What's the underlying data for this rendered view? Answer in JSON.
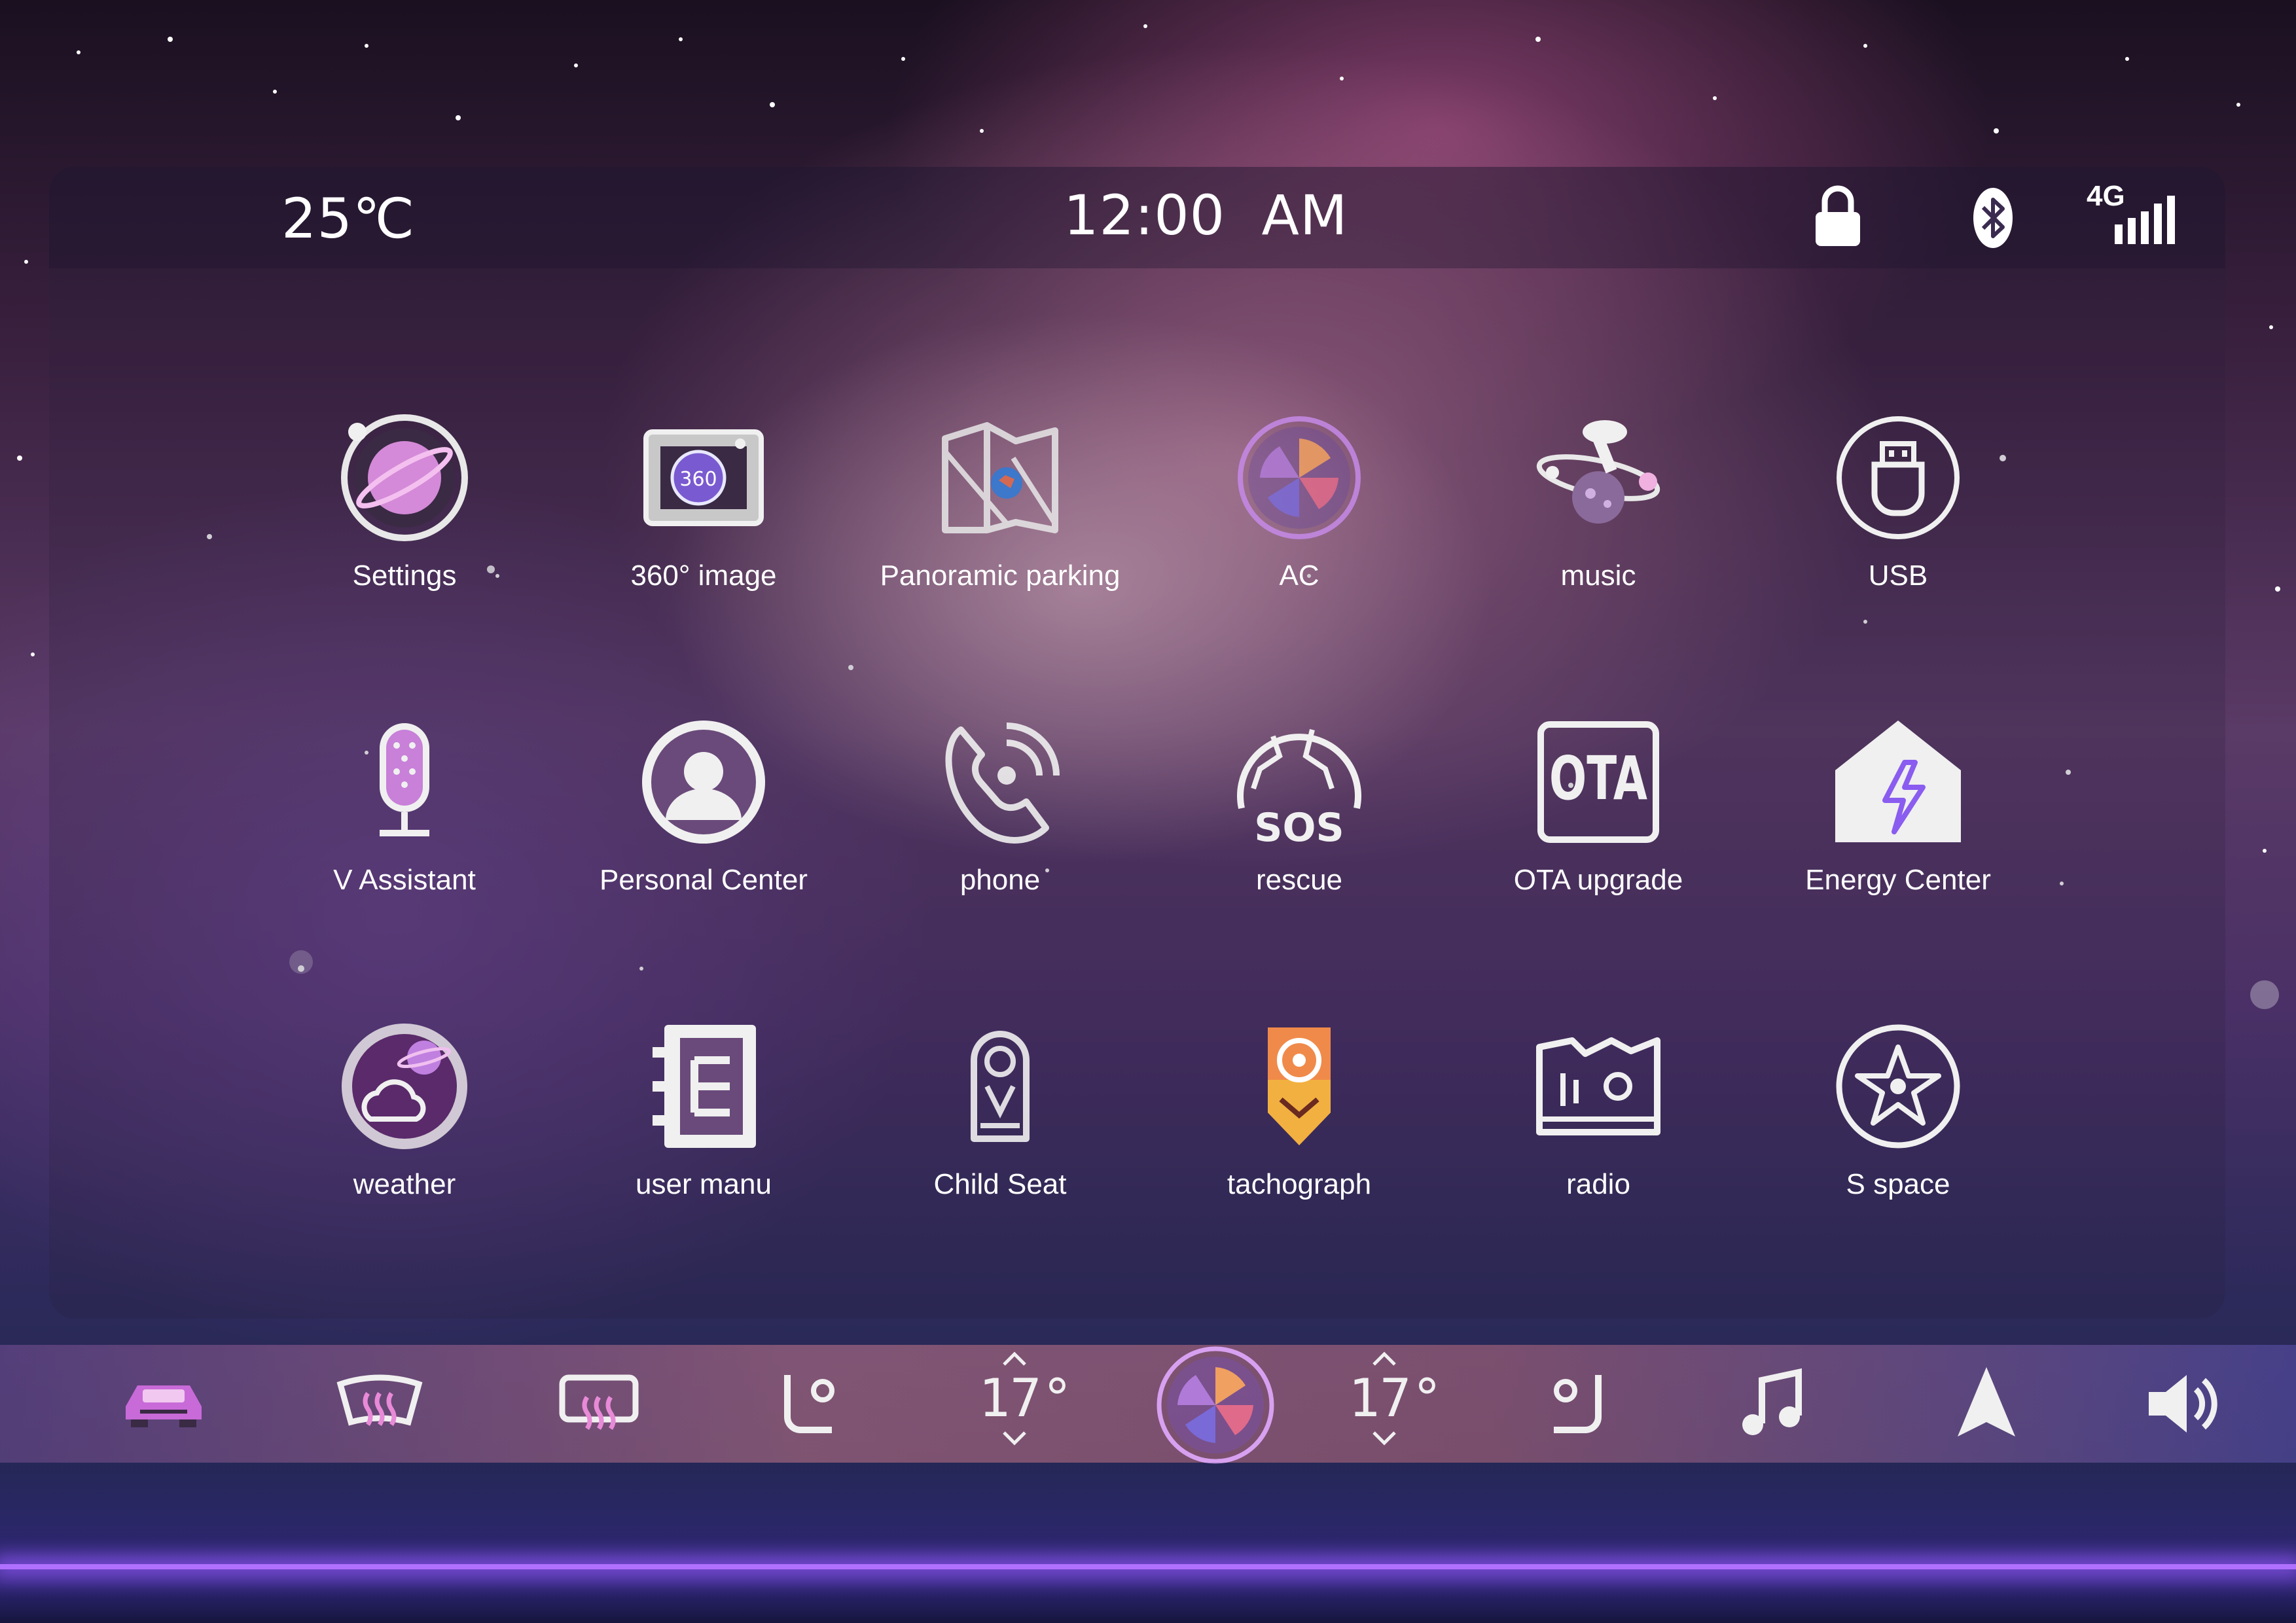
{
  "status": {
    "temperature": "25℃",
    "time": "12:00  AM",
    "network": "4G"
  },
  "apps": [
    {
      "label": "Settings",
      "icon": "settings-planet-icon"
    },
    {
      "label": "360° image",
      "icon": "camera-360-icon"
    },
    {
      "label": "Panoramic parking",
      "icon": "map-location-icon"
    },
    {
      "label": "AC",
      "icon": "fan-icon"
    },
    {
      "label": "music",
      "icon": "astronaut-music-icon"
    },
    {
      "label": "USB",
      "icon": "usb-icon"
    },
    {
      "label": "V Assistant",
      "icon": "microphone-icon"
    },
    {
      "label": "Personal Center",
      "icon": "user-avatar-icon"
    },
    {
      "label": "phone",
      "icon": "phone-icon"
    },
    {
      "label": "rescue",
      "icon": "sos-globe-icon"
    },
    {
      "label": "OTA upgrade",
      "icon": "ota-icon"
    },
    {
      "label": "Energy Center",
      "icon": "energy-house-icon"
    },
    {
      "label": "weather",
      "icon": "weather-planet-icon"
    },
    {
      "label": "user manu",
      "icon": "manual-book-icon"
    },
    {
      "label": "Child Seat",
      "icon": "child-seat-icon"
    },
    {
      "label": "tachograph",
      "icon": "tachograph-camera-icon"
    },
    {
      "label": "radio",
      "icon": "radio-icon"
    },
    {
      "label": "S space",
      "icon": "compass-star-icon"
    }
  ],
  "dock": {
    "left_temp": "17°",
    "right_temp": "17°",
    "items": [
      "car-icon",
      "front-defrost-icon",
      "rear-defrost-icon",
      "driver-seat-icon",
      "left-temp-control",
      "ac-fan-button",
      "right-temp-control",
      "passenger-seat-icon",
      "music-note-icon",
      "navigation-icon",
      "volume-icon"
    ]
  },
  "colors": {
    "accent_pink": "#e87ad8",
    "accent_purple": "#8a5cf0",
    "neon": "#b070ff"
  }
}
